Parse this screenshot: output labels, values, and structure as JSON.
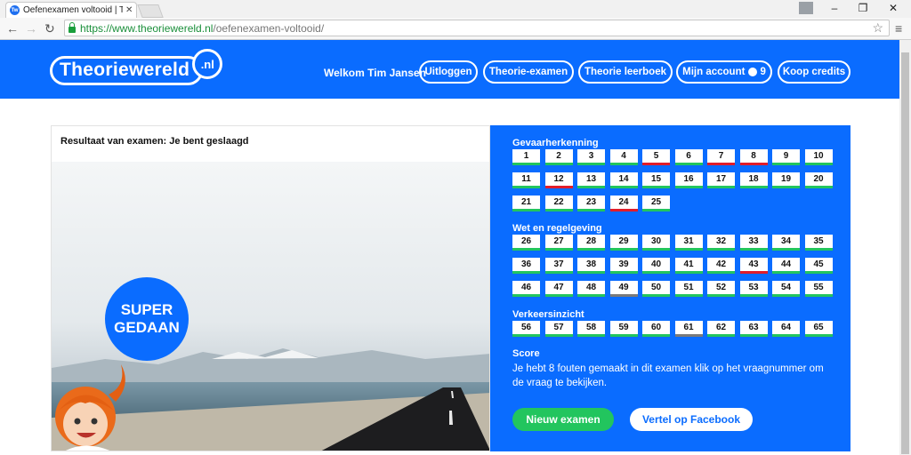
{
  "browser": {
    "tab_title": "Oefenexamen voltooid | Th",
    "tab_favicon": "Tw",
    "url_host": "https://www.theoriewereld.nl",
    "url_path": "/oefenexamen-voltooid/"
  },
  "header": {
    "logo_main": "Theoriewereld",
    "logo_nl": ".nl",
    "welcome": "Welkom Tim Jansen",
    "nav": {
      "logout": "Uitloggen",
      "exam": "Theorie-examen",
      "book": "Theorie leerboek",
      "account": "Mijn account",
      "credits_count": "9",
      "buy": "Koop credits"
    }
  },
  "result": {
    "title": "Resultaat van examen: Je bent geslaagd",
    "bubble_line1": "SUPER",
    "bubble_line2": "GEDAAN"
  },
  "sections": [
    {
      "title": "Gevaarherkenning",
      "questions": [
        {
          "n": "1",
          "s": "ok"
        },
        {
          "n": "2",
          "s": "ok"
        },
        {
          "n": "3",
          "s": "ok"
        },
        {
          "n": "4",
          "s": "ok"
        },
        {
          "n": "5",
          "s": "wrong"
        },
        {
          "n": "6",
          "s": "ok"
        },
        {
          "n": "7",
          "s": "wrong"
        },
        {
          "n": "8",
          "s": "wrong"
        },
        {
          "n": "9",
          "s": "ok"
        },
        {
          "n": "10",
          "s": "ok"
        },
        {
          "n": "11",
          "s": "ok"
        },
        {
          "n": "12",
          "s": "wrong"
        },
        {
          "n": "13",
          "s": "ok"
        },
        {
          "n": "14",
          "s": "ok"
        },
        {
          "n": "15",
          "s": "ok"
        },
        {
          "n": "16",
          "s": "ok"
        },
        {
          "n": "17",
          "s": "ok"
        },
        {
          "n": "18",
          "s": "ok"
        },
        {
          "n": "19",
          "s": "ok"
        },
        {
          "n": "20",
          "s": "ok"
        },
        {
          "n": "21",
          "s": "ok"
        },
        {
          "n": "22",
          "s": "ok"
        },
        {
          "n": "23",
          "s": "ok"
        },
        {
          "n": "24",
          "s": "wrong"
        },
        {
          "n": "25",
          "s": "ok"
        }
      ]
    },
    {
      "title": "Wet en regelgeving",
      "questions": [
        {
          "n": "26",
          "s": "ok"
        },
        {
          "n": "27",
          "s": "ok"
        },
        {
          "n": "28",
          "s": "ok"
        },
        {
          "n": "29",
          "s": "ok"
        },
        {
          "n": "30",
          "s": "ok"
        },
        {
          "n": "31",
          "s": "ok"
        },
        {
          "n": "32",
          "s": "ok"
        },
        {
          "n": "33",
          "s": "ok"
        },
        {
          "n": "34",
          "s": "ok"
        },
        {
          "n": "35",
          "s": "ok"
        },
        {
          "n": "36",
          "s": "ok"
        },
        {
          "n": "37",
          "s": "ok"
        },
        {
          "n": "38",
          "s": "ok"
        },
        {
          "n": "39",
          "s": "ok"
        },
        {
          "n": "40",
          "s": "ok"
        },
        {
          "n": "41",
          "s": "ok"
        },
        {
          "n": "42",
          "s": "ok"
        },
        {
          "n": "43",
          "s": "wrong"
        },
        {
          "n": "44",
          "s": "ok"
        },
        {
          "n": "45",
          "s": "ok"
        },
        {
          "n": "46",
          "s": "ok"
        },
        {
          "n": "47",
          "s": "ok"
        },
        {
          "n": "48",
          "s": "ok"
        },
        {
          "n": "49",
          "s": "gray"
        },
        {
          "n": "50",
          "s": "ok"
        },
        {
          "n": "51",
          "s": "ok"
        },
        {
          "n": "52",
          "s": "ok"
        },
        {
          "n": "53",
          "s": "ok"
        },
        {
          "n": "54",
          "s": "ok"
        },
        {
          "n": "55",
          "s": "ok"
        }
      ]
    },
    {
      "title": "Verkeersinzicht",
      "questions": [
        {
          "n": "56",
          "s": "ok"
        },
        {
          "n": "57",
          "s": "ok"
        },
        {
          "n": "58",
          "s": "ok"
        },
        {
          "n": "59",
          "s": "ok"
        },
        {
          "n": "60",
          "s": "ok"
        },
        {
          "n": "61",
          "s": "gray"
        },
        {
          "n": "62",
          "s": "ok"
        },
        {
          "n": "63",
          "s": "ok"
        },
        {
          "n": "64",
          "s": "ok"
        },
        {
          "n": "65",
          "s": "ok"
        }
      ]
    }
  ],
  "score": {
    "title": "Score",
    "text": "Je hebt 8 fouten gemaakt in dit examen klik op het vraagnummer om de vraag te bekijken."
  },
  "buttons": {
    "new_exam": "Nieuw examen",
    "facebook": "Vertel op Facebook"
  },
  "colors": {
    "brand_blue": "#0a6cff",
    "correct_green": "#22c55e",
    "wrong_red": "#e11d2a",
    "skipped_gray": "#7a7a7a"
  }
}
